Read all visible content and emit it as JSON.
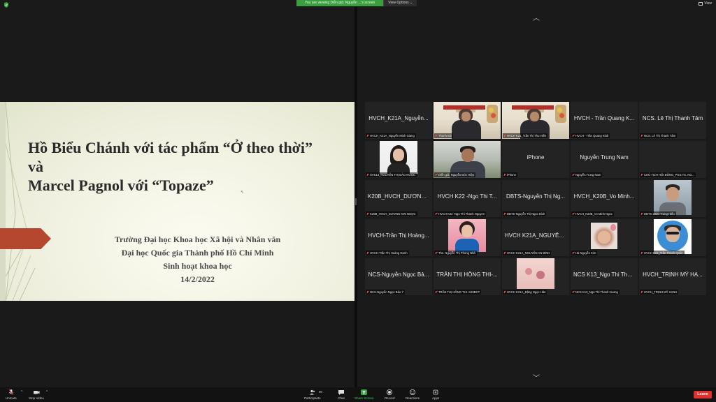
{
  "banner": {
    "message": "You are viewing Diễn giả: Nguyễn ...'s screen",
    "view_options": "View Options ⌄"
  },
  "top_right": {
    "view_label": "View"
  },
  "slide": {
    "title_line1": "Hồ Biểu Chánh với tác phẩm “Ở theo thời”",
    "title_line2": "và",
    "title_line3": "Marcel Pagnol với “Topaze”",
    "info_line1": "Trường Đại học Khoa học Xã hội và Nhân văn",
    "info_line2": "Đại học Quốc gia Thành phố Hồ Chí Minh",
    "info_line3": "Sinh hoạt khoa học",
    "info_line4": "14/2/2022"
  },
  "tiles": [
    {
      "name": "HVCH_K21A_Nguyễn...",
      "label": "HVCH_K21A_Nguyễn Minh Giang",
      "video": "none"
    },
    {
      "name": "",
      "label": "Thanh Bùi",
      "video": "meeting"
    },
    {
      "name": "",
      "label": "HVCH K21_Trần Thị Thu Hiền",
      "video": "meeting"
    },
    {
      "name": "HVCH - Trần Quang K...",
      "label": "HVCH - Trần Quang Khải",
      "video": "none"
    },
    {
      "name": "NCS. Lê Thị Thanh Tâm",
      "label": "NCS. Lê Thị Thanh Tâm",
      "video": "none"
    },
    {
      "name": "",
      "label": "SVK13_NGUYỄN THỊ BẢO NGỌC",
      "video": "girl"
    },
    {
      "name": "",
      "label": "Diễn giả: Nguyễn Đức Hiệp",
      "video": "office",
      "active": true
    },
    {
      "name": "iPhone",
      "label": "iPhone",
      "video": "none"
    },
    {
      "name": "Nguyễn Trung Nam",
      "label": "Nguyễn Trung Nam",
      "video": "none"
    },
    {
      "name": "",
      "label": "CHỦ TỊCH HỘI ĐỒNG_PGS.TS. NG...",
      "video": "none"
    },
    {
      "name": "K20B_HVCH_DƯƠNG...",
      "label": "K20B_HVCH_DƯƠNG KIM NGỌC",
      "video": "none"
    },
    {
      "name": "HVCH K22 -Ngo Thi T...",
      "label": "HVCH K22 -Ngo Thi Thanh Nguyen",
      "video": "none"
    },
    {
      "name": "DBTS-Nguyễn Thị Ng...",
      "label": "DBTS-Nguyễn Thị Ngọc Bích",
      "video": "none"
    },
    {
      "name": "HVCH_K20B_Vo Minh...",
      "label": "HVCH_K20B_Vo Minh Ngoc",
      "video": "none"
    },
    {
      "name": "",
      "label": "DBTS 2020-Trung Hiếu",
      "video": "man2"
    },
    {
      "name": "HVCH-Trần Thị Hoàng...",
      "label": "HVCH-Trần Thị Hoàng Oanh",
      "video": "none"
    },
    {
      "name": "",
      "label": "Ths. Nguyễn Thị Phong Nhã",
      "video": "lady"
    },
    {
      "name": "HVCH K21A_NGUYỄN...",
      "label": "HVCH K21A_NGUYỄN AN BÌNH",
      "video": "none"
    },
    {
      "name": "",
      "label": "Hà Nguyễn Kim",
      "video": "cat"
    },
    {
      "name": "",
      "label": "HVCH K21_Trần Thành Quân",
      "video": "avatar"
    },
    {
      "name": "NCS-Nguyễn Ngọc Bả...",
      "label": "NCS-Nguyễn Ngọc Bảo Ý",
      "video": "none"
    },
    {
      "name": "TRẦN THỊ HỒNG THI-...",
      "label": "TRẦN THỊ HỒNG THI- K20BCT",
      "video": "none"
    },
    {
      "name": "",
      "label": "HVCH K21A_Đặng Ngọc Hân",
      "video": "flowers"
    },
    {
      "name": "NCS K13_Ngo Thi Tha...",
      "label": "NCS K13_Ngo Thi Thanh Huong",
      "video": "none"
    },
    {
      "name": "HVCH_TRỊNH MỸ HẠ...",
      "label": "HVCH_TRỊNH MỸ HẠNH",
      "video": "none"
    }
  ],
  "toolbar": {
    "unmute": "Unmute",
    "stop_video": "Stop Video",
    "participants": "Participants",
    "participants_count": "90",
    "chat": "Chat",
    "share_screen": "Share Screen",
    "record": "Record",
    "reactions": "Reactions",
    "apps": "Apps",
    "leave": "Leave"
  },
  "colors": {
    "accent_green": "#3aa845",
    "leave_red": "#e0312f",
    "slide_arrow": "#b5472f"
  }
}
